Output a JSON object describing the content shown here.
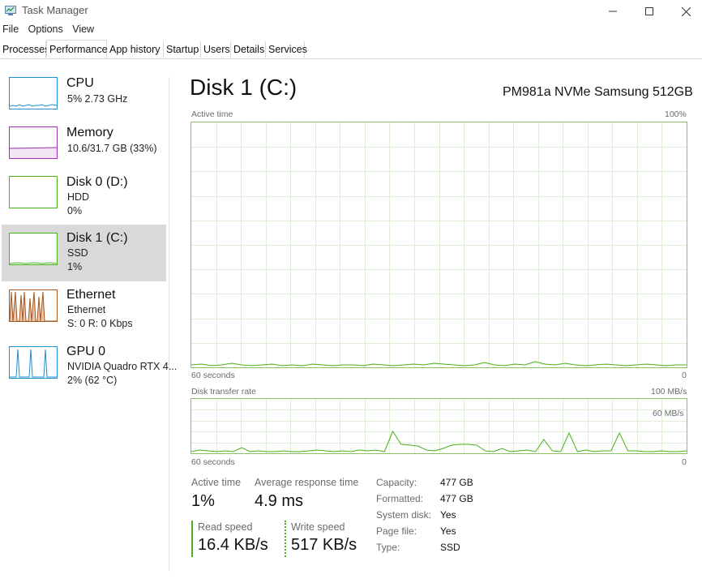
{
  "window": {
    "title": "Task Manager",
    "minimize_icon": "minimize-icon",
    "maximize_icon": "maximize-icon",
    "close_icon": "close-icon"
  },
  "menu": [
    "File",
    "Options",
    "View"
  ],
  "tabs": [
    "Processes",
    "Performance",
    "App history",
    "Startup",
    "Users",
    "Details",
    "Services"
  ],
  "active_tab": "Performance",
  "sidebar": [
    {
      "title": "CPU",
      "line1": "5%  2.73 GHz",
      "line2": "",
      "color": "#1f8fd0"
    },
    {
      "title": "Memory",
      "line1": "10.6/31.7 GB (33%)",
      "line2": "",
      "color": "#9c2fb3"
    },
    {
      "title": "Disk 0 (D:)",
      "line1": "HDD",
      "line2": "0%",
      "color": "#4caf1c"
    },
    {
      "title": "Disk 1 (C:)",
      "line1": "SSD",
      "line2": "1%",
      "color": "#4caf1c"
    },
    {
      "title": "Ethernet",
      "line1": "Ethernet",
      "line2": "S: 0  R: 0 Kbps",
      "color": "#a7561c"
    },
    {
      "title": "GPU 0",
      "line1": "NVIDIA Quadro RTX 4...",
      "line2": "2%  (62 °C)",
      "color": "#1f8fd0"
    }
  ],
  "main": {
    "title": "Disk 1 (C:)",
    "device": "PM981a NVMe Samsung 512GB",
    "active_graph": {
      "label": "Active time",
      "max_label": "100%",
      "time_label": "60 seconds",
      "min_label": "0"
    },
    "rate_graph": {
      "label": "Disk transfer rate",
      "max_label": "100 MB/s",
      "mid_label": "60 MB/s",
      "time_label": "60 seconds",
      "min_label": "0"
    },
    "stats": {
      "active_time_label": "Active time",
      "active_time_value": "1%",
      "avg_response_label": "Average response time",
      "avg_response_value": "4.9 ms",
      "read_label": "Read speed",
      "read_value": "16.4 KB/s",
      "write_label": "Write speed",
      "write_value": "517 KB/s"
    },
    "properties": [
      {
        "label": "Capacity:",
        "value": "477 GB"
      },
      {
        "label": "Formatted:",
        "value": "477 GB"
      },
      {
        "label": "System disk:",
        "value": "Yes"
      },
      {
        "label": "Page file:",
        "value": "Yes"
      },
      {
        "label": "Type:",
        "value": "SSD"
      }
    ]
  },
  "colors": {
    "disk_green": "#4caf1c",
    "graph_border": "#8cc068",
    "grid": "#dfeed6",
    "selected_bg": "#d9d9d9"
  }
}
